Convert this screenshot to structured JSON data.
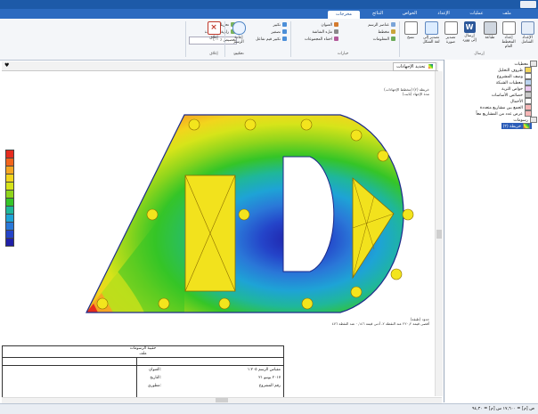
{
  "tabs": [
    {
      "label": "ملف"
    },
    {
      "label": "عمليات"
    },
    {
      "label": "الإعداد"
    },
    {
      "label": "الخواص"
    },
    {
      "label": "النتائج"
    },
    {
      "label": "مخرجات"
    }
  ],
  "ribbon": {
    "big_buttons": [
      {
        "label": "الإعداد\nالشامل"
      },
      {
        "label": "إعداد المخطط\nالعام"
      },
      {
        "label": "طباعة"
      },
      {
        "label": "إرسال\nإلى وورد"
      },
      {
        "label": "تصدير\nصورة"
      },
      {
        "label": "تصدير إلى\nلغة الشكل"
      },
      {
        "label": "نسخ"
      }
    ],
    "view_rows": [
      "عناصر الرسم",
      "العنوان",
      "مخطط",
      "بحث",
      "ملء الشاشة",
      "المعلومات",
      "اخفاء المجموعات"
    ],
    "zoom_rows": [
      "تكبير",
      "تصغير",
      "تحريك",
      "زاوية المشاهدة",
      "تكبير قيم تفاعل",
      "تخصيص ٪ ١٠٠"
    ],
    "refresh_label": "إعادة\nالرسم",
    "close_label": "إغلاق",
    "groups": {
      "view": "خيارات",
      "zoom": "تكبير",
      "update": "تحديث",
      "close": "إغلاق",
      "send": "إرسال",
      "print": "طباعة"
    }
  },
  "doc": {
    "tab_title": "تحديد الإجهادات"
  },
  "legend": {
    "colors": [
      "#e62b1e",
      "#f2641c",
      "#f5a623",
      "#f2d51d",
      "#d6e41a",
      "#8fd51c",
      "#35c527",
      "#1fb79a",
      "#1ea3d6",
      "#2a78d8",
      "#2444c9",
      "#1f1fa8"
    ]
  },
  "chart_notes": {
    "top": [
      "خريطة (٢) (مخطط الإجهادات)",
      "مدة الإجهاد (ثابت)"
    ],
    "bottom": [
      "حدود (طبقة)",
      "أقصى قيمة ٢٢٠,٢ عند النقطة ٢، أدنى قيمة ٠,١٤٦ عند النقطة ٤٧٦"
    ]
  },
  "infobox": {
    "header": [
      "حقيبة الرسومات",
      "ملف"
    ],
    "rows": [
      {
        "label": "العنوان:",
        "value": "مقياس الرسم ١:٢٠٥"
      },
      {
        "label": "التاريخ:",
        "value": "٢٠١٧ يونيو ٢١"
      },
      {
        "label": "مطوري:",
        "value": "رقم المشروع"
      }
    ]
  },
  "tree": {
    "items": [
      {
        "label": "معطيات",
        "indent": 0
      },
      {
        "label": "ظروف التحليل",
        "indent": 1
      },
      {
        "label": "وصف المشروع",
        "indent": 1
      },
      {
        "label": "معطيات الشبكة",
        "indent": 1
      },
      {
        "label": "خواص التربة",
        "indent": 1
      },
      {
        "label": "خصائص الأساسات",
        "indent": 1
      },
      {
        "label": "الأحمال",
        "indent": 1
      },
      {
        "label": "الجمع بين مشاريع متعددة",
        "indent": 1
      },
      {
        "label": "عرض عدد من المشاريع معاً",
        "indent": 1
      },
      {
        "label": "رسومات",
        "indent": 0
      },
      {
        "label": "خريطة (٢)",
        "indent": 1,
        "selected": true
      }
    ]
  },
  "status": {
    "left": "ص [م] = ١٧,٦٠٠  س [م] = ٩٤,٣٠"
  }
}
